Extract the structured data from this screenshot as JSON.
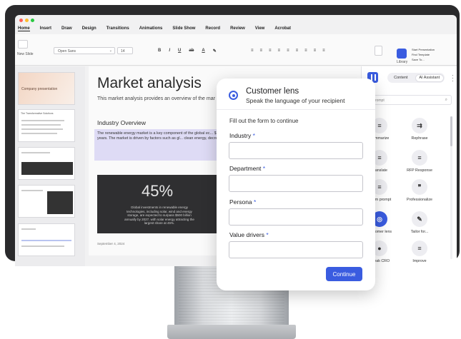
{
  "app": {
    "menu": [
      "Home",
      "Insert",
      "Draw",
      "Design",
      "Transitions",
      "Animations",
      "Slide Show",
      "Record",
      "Review",
      "View",
      "Acrobat"
    ],
    "traffic_colors": [
      "#ff5f57",
      "#febc2e",
      "#28c840"
    ],
    "ribbon": {
      "new_slide": "New Slide",
      "font_name": "Open Sans",
      "font_size": "14",
      "library_label": "Library",
      "quick_actions": [
        "Start Presentation",
        "Find Template",
        "Save To..."
      ]
    }
  },
  "thumbnails": {
    "first_title": "Company presentation",
    "second_title": "The Transformative Solutions"
  },
  "slide": {
    "title": "Market analysis",
    "subtitle": "This market analysis provides an overview of the mar",
    "section_heading": "Industry Overview",
    "paragraph": "The renewable energy market is a key component of the global ec... $1.2 trillion as of 2024. It is expected to grow at a compound ann... over the next five years. The market is driven by factors such as gl... clean energy, decreasing costs of renewable technologies, and i... sustainable energy solutions.",
    "stat_value": "45%",
    "stat_desc": "Global investments in renewable energy technologies, including solar, wind and energy storage, are expected to surpass $500 billion annually by 2027, with solar energy attracting the largest share at 45%.",
    "footer": "September 4, 2024"
  },
  "assistant_panel": {
    "tabs": [
      "Content",
      "AI Assistant"
    ],
    "active_tab": "AI Assistant",
    "search_placeholder": "e prompt",
    "tools": [
      {
        "label": "Summarize",
        "glyph": "≡"
      },
      {
        "label": "Rephrase",
        "glyph": "⇉"
      },
      {
        "label": "Translate",
        "glyph": "≡"
      },
      {
        "label": "RFP Response",
        "glyph": "≡"
      },
      {
        "label": "ustom prompt",
        "glyph": "≡"
      },
      {
        "label": "Professionalize",
        "glyph": "❞"
      },
      {
        "label": "Customer lens",
        "glyph": "◎"
      },
      {
        "label": "Tailor for...",
        "glyph": "✎"
      },
      {
        "label": "Speak CRO",
        "glyph": "●"
      },
      {
        "label": "Improve",
        "glyph": "≡"
      }
    ]
  },
  "modal": {
    "title": "Customer lens",
    "subtitle": "Speak the language of your recipient",
    "instruction": "Fill out the form to continue",
    "fields": [
      {
        "label": "Industry",
        "value": ""
      },
      {
        "label": "Department",
        "value": ""
      },
      {
        "label": "Persona",
        "value": ""
      },
      {
        "label": "Value drivers",
        "value": ""
      }
    ],
    "required_mark": "*",
    "continue_label": "Continue"
  },
  "colors": {
    "accent": "#3a5ce0",
    "monitor_bezel": "#2a2a2c",
    "paragraph_highlight": "#dedbf5"
  }
}
